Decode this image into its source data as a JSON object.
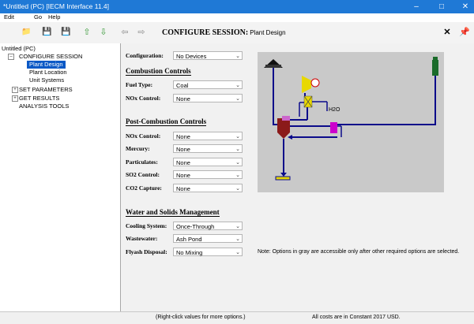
{
  "window": {
    "title": "*Untitled (PC) [IECM Interface 11.4]"
  },
  "menu": {
    "items": [
      "Edit",
      "Go",
      "Help"
    ]
  },
  "header": {
    "title": "CONFIGURE SESSION:",
    "subtitle": "Plant Design"
  },
  "tree": {
    "root": "Untitled (PC)",
    "configure_session": "CONFIGURE SESSION",
    "plant_design": "Plant Design",
    "plant_location": "Plant Location",
    "unit_systems": "Unit Systems",
    "set_parameters": "SET PARAMETERS",
    "get_results": "GET RESULTS",
    "analysis_tools": "ANALYSIS TOOLS"
  },
  "form": {
    "configuration": {
      "label": "Configuration:",
      "value": "No Devices"
    },
    "combustion_title": "Combustion Controls",
    "fuel_type": {
      "label": "Fuel Type:",
      "value": "Coal"
    },
    "nox_control_comb": {
      "label": "NOx Control:",
      "value": "None"
    },
    "post_title": "Post-Combustion Controls",
    "nox_control_post": {
      "label": "NOx Control:",
      "value": "None"
    },
    "mercury": {
      "label": "Mercury:",
      "value": "None"
    },
    "particulates": {
      "label": "Particulates:",
      "value": "None"
    },
    "so2_control": {
      "label": "SO2 Control:",
      "value": "None"
    },
    "co2_capture": {
      "label": "CO2 Capture:",
      "value": "None"
    },
    "water_title": "Water and Solids Management",
    "cooling_system": {
      "label": "Cooling System:",
      "value": "Once-Through"
    },
    "wastewater": {
      "label": "Wastewater:",
      "value": "Ash Pond"
    },
    "flyash_disposal": {
      "label": "Flyash Disposal:",
      "value": "No Mixing"
    }
  },
  "diagram": {
    "h2o_label": "H2O"
  },
  "note": "Note: Options in gray are accessible only after other required options are selected.",
  "status": {
    "hint": "(Right-click values for more options.)",
    "costs": "All costs are in Constant 2017 USD."
  },
  "colors": {
    "titlebar": "#1f79d6",
    "selection": "#0a59c6",
    "boiler": "#8b1a1a",
    "pipe": "#0b0b8a"
  }
}
